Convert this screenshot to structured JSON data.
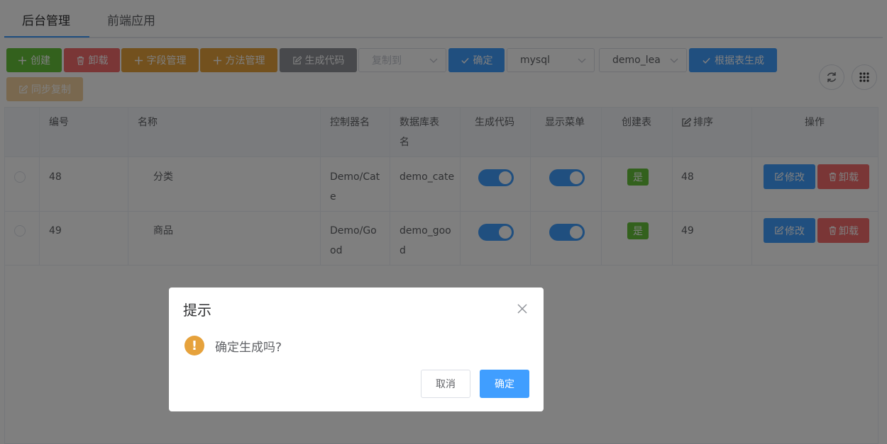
{
  "tabs": [
    {
      "label": "后台管理",
      "active": true
    },
    {
      "label": "前端应用",
      "active": false
    }
  ],
  "toolbar": {
    "create": "创建",
    "uninstall": "卸载",
    "field_manage": "字段管理",
    "method_manage": "方法管理",
    "generate_code": "生成代码",
    "copy_to": "复制到",
    "confirm": "确定",
    "db_type": "mysql",
    "table_select": "demo_lea",
    "generate_from_table": "根据表生成",
    "sync_copy": "同步复制"
  },
  "table": {
    "headers": {
      "id": "编号",
      "name": "名称",
      "controller": "控制器名",
      "db_table_line1": "数据库表",
      "db_table_line2": "名",
      "gen_code": "生成代码",
      "show_menu": "显示菜单",
      "create_table": "创建表",
      "sort": "排序",
      "actions": "操作"
    },
    "rows": [
      {
        "id": "48",
        "name": "分类",
        "controller_l1": "Demo/Cat",
        "controller_l2": "e",
        "db_l1": "demo_cate",
        "db_l2": "",
        "gen_code": true,
        "show_menu": true,
        "create_table": "是",
        "sort": "48",
        "edit": "修改",
        "uninstall": "卸载"
      },
      {
        "id": "49",
        "name": "商品",
        "controller_l1": "Demo/Go",
        "controller_l2": "od",
        "db_l1": "demo_goo",
        "db_l2": "d",
        "gen_code": true,
        "show_menu": true,
        "create_table": "是",
        "sort": "49",
        "edit": "修改",
        "uninstall": "卸载"
      }
    ]
  },
  "dialog": {
    "title": "提示",
    "message": "确定生成吗?",
    "cancel": "取消",
    "ok": "确定"
  },
  "colors": {
    "primary": "#409eff",
    "success": "#67c23a",
    "danger": "#f56c6c",
    "warning": "#e6a23c",
    "info": "#909399"
  }
}
